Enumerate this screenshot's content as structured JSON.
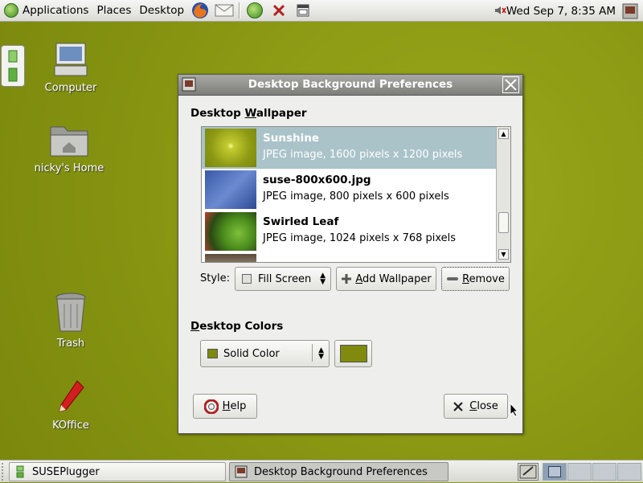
{
  "top_panel": {
    "menus": [
      "Applications",
      "Places",
      "Desktop"
    ],
    "clock": "Wed Sep  7,  8:35 AM"
  },
  "desktop_icons": [
    {
      "label": "Computer"
    },
    {
      "label": "nicky's Home"
    },
    {
      "label": "Trash"
    },
    {
      "label": "KOffice"
    }
  ],
  "dialog": {
    "title": "Desktop Background Preferences",
    "wallpaper_section_label": "Desktop Wallpaper",
    "wallpapers": [
      {
        "name": "Sunshine",
        "desc": "JPEG image, 1600 pixels x 1200 pixels",
        "selected": true
      },
      {
        "name": "suse-800x600.jpg",
        "desc": "JPEG image, 800 pixels x 600 pixels",
        "selected": false
      },
      {
        "name": "Swirled Leaf",
        "desc": "JPEG image, 1024 pixels x 768 pixels",
        "selected": false
      }
    ],
    "style_label": "Style:",
    "style_value": "Fill Screen",
    "add_wallpaper_label": "Add Wallpaper",
    "remove_label": "Remove",
    "colors_section_label": "Desktop Colors",
    "color_mode_value": "Solid Color",
    "color_value": "#7f8a0e",
    "help_label": "Help",
    "close_label": "Close"
  },
  "taskbar": {
    "tasks": [
      {
        "label": "SUSEPlugger",
        "active": false
      },
      {
        "label": "Desktop Background Preferences",
        "active": true
      }
    ]
  }
}
